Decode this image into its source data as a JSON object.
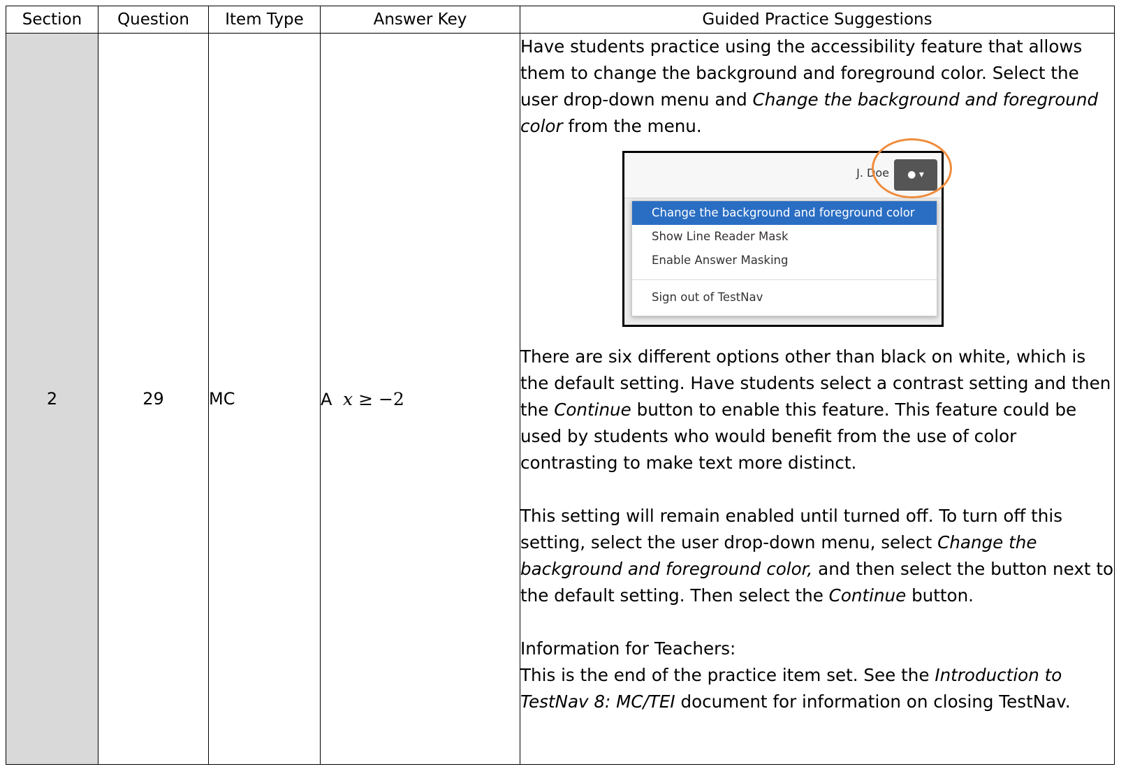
{
  "headers": {
    "section": "Section",
    "question": "Question",
    "item_type": "Item Type",
    "answer_key": "Answer Key",
    "guided": "Guided Practice Suggestions"
  },
  "row": {
    "section": "2",
    "question": "29",
    "item_type": "MC",
    "answer_letter": "A",
    "answer_var": "x",
    "answer_rel": "≥ −2"
  },
  "guided": {
    "p1": [
      "Have students practice using the accessibility feature that allows them to change the background and foreground color. Select the user drop-down menu and ",
      "Change the background and foreground color",
      " from the menu."
    ],
    "screenshot": {
      "user_name": "J. Doe",
      "menu_items": [
        "Change the background and foreground color",
        "Show Line Reader Mask",
        "Enable Answer Masking"
      ],
      "sign_out": "Sign out of TestNav"
    },
    "p2": [
      "There are six different options other than black on white, which is the default setting. Have students select a contrast setting and then the ",
      "Continue",
      " button to enable this feature. This feature could be used by students who would benefit from the use of color contrasting to make text more distinct."
    ],
    "p3": [
      "This setting will remain enabled until turned off. To turn off this setting, select the user drop-down menu, select ",
      "Change the background and foreground color,",
      " and then select the button next to the default setting.  Then select the ",
      "Continue",
      " button."
    ],
    "p4_heading": "Information for Teachers:",
    "p4": [
      "This is the end of the practice item set.  See the ",
      "Introduction to TestNav 8:  MC/TEI",
      " document for information on closing TestNav."
    ]
  }
}
